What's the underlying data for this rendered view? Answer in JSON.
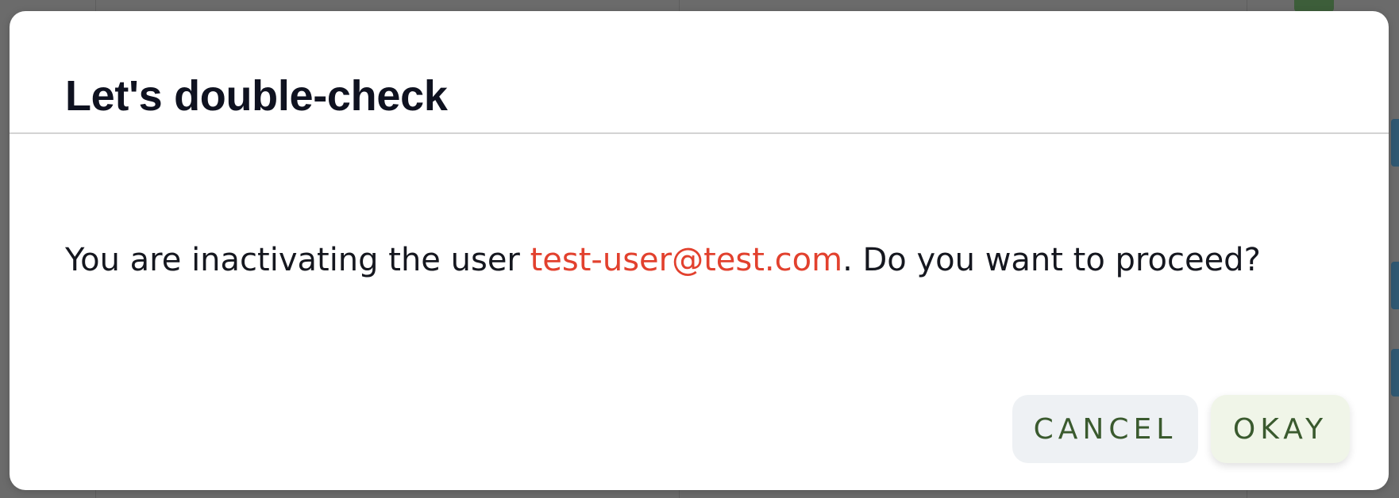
{
  "dialog": {
    "title": "Let's double-check",
    "message_prefix": "You are inactivating the user ",
    "email": "test-user@test.com",
    "message_suffix": ". Do you want to proceed?",
    "cancel_label": "CANCEL",
    "okay_label": "OKAY"
  },
  "colors": {
    "email_accent": "#e2412e",
    "button_text": "#3a5a2e",
    "cancel_bg": "#eef1f4",
    "okay_bg": "#f0f5e8",
    "title": "#0f1220",
    "overlay": "#6b6b6b"
  }
}
